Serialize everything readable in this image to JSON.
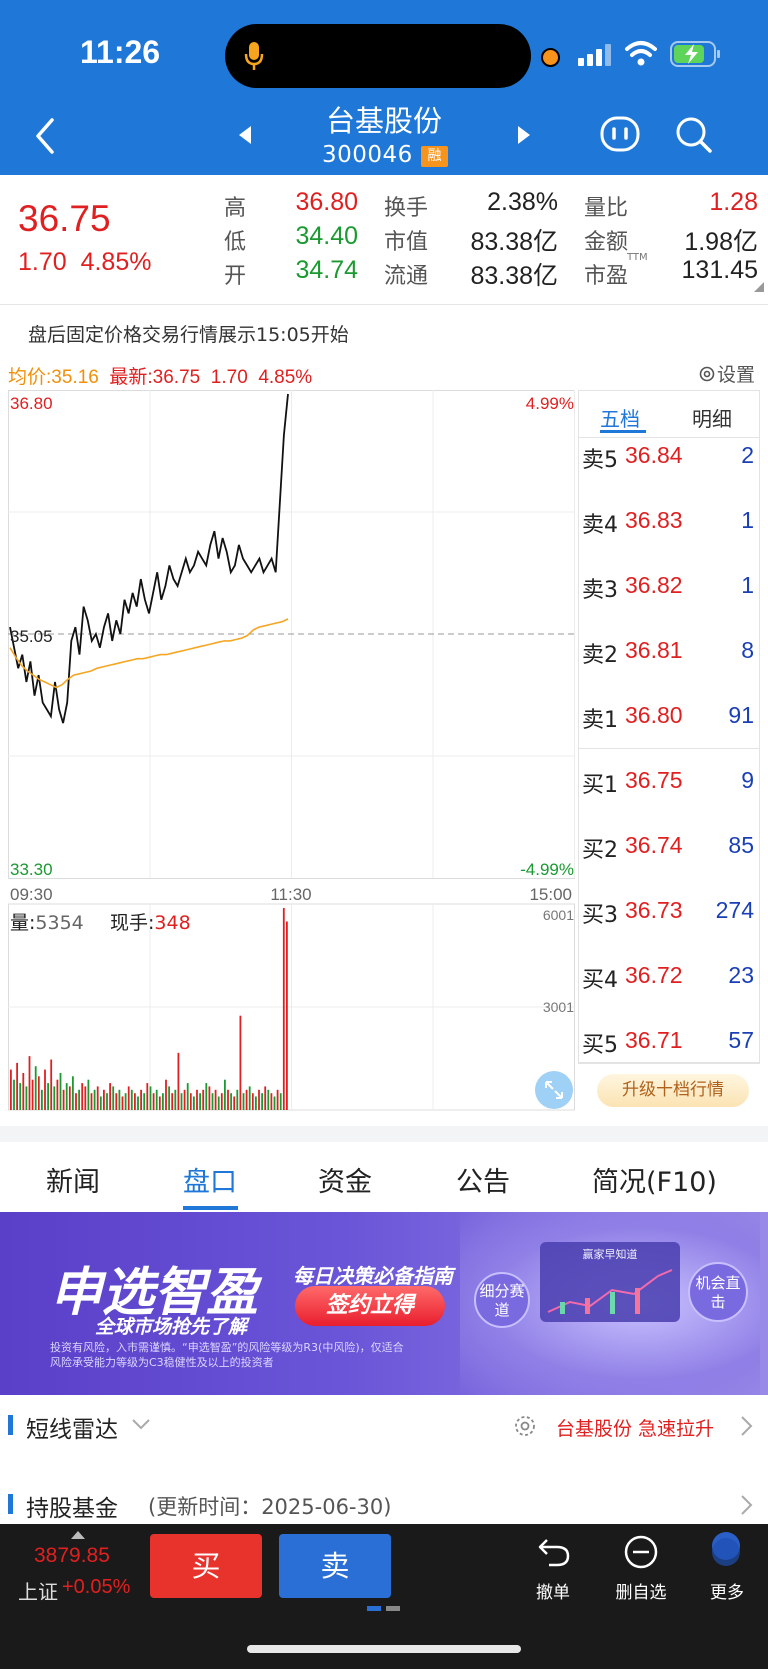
{
  "status_bar": {
    "time": "11:26"
  },
  "header": {
    "title": "台基股份",
    "code": "300046",
    "badge": "融"
  },
  "quote": {
    "price": "36.75",
    "change": "1.70",
    "change_pct": "4.85%",
    "stats": [
      {
        "label": "高",
        "value": "36.80",
        "color": "#e02020"
      },
      {
        "label": "换手",
        "value": "2.38%",
        "color": "#222222"
      },
      {
        "label": "量比",
        "value": "1.28",
        "color": "#e02020"
      },
      {
        "label": "低",
        "value": "34.40",
        "color": "#1a9a30"
      },
      {
        "label": "市值",
        "value": "83.38亿",
        "color": "#222222"
      },
      {
        "label": "金额",
        "value": "1.98亿",
        "color": "#222222"
      },
      {
        "label": "开",
        "value": "34.74",
        "color": "#1a9a30"
      },
      {
        "label": "流通",
        "value": "83.38亿",
        "color": "#222222"
      },
      {
        "label": "市盈",
        "value": "131.45",
        "color": "#222222"
      }
    ],
    "pe_suffix": "TTM"
  },
  "notice": "盘后固定价格交易行情展示15:05开始",
  "chart_header": {
    "avg_label": "均价:35.16",
    "latest_label": "最新:36.75",
    "latest_chg": "1.70",
    "latest_pct": "4.85%",
    "settings": "设置"
  },
  "chart_data": {
    "type": "line",
    "y_high": "36.80",
    "y_mid": "35.05",
    "y_low": "33.30",
    "pct_high": "4.99%",
    "pct_low": "-4.99%",
    "x_ticks": [
      "09:30",
      "11:30",
      "15:00"
    ],
    "ylim": [
      33.3,
      36.8
    ],
    "series": [
      {
        "values": [
          35.1,
          34.95,
          34.8,
          34.9,
          34.7,
          34.85,
          34.6,
          34.75,
          34.55,
          34.5,
          34.45,
          34.7,
          34.5,
          34.4,
          34.55,
          35.0,
          35.1,
          34.9,
          35.25,
          35.15,
          35.0,
          35.05,
          34.95,
          35.1,
          35.2,
          35.0,
          35.15,
          35.05,
          35.3,
          35.2,
          35.35,
          35.25,
          35.45,
          35.3,
          35.2,
          35.35,
          35.5,
          35.3,
          35.4,
          35.55,
          35.45,
          35.4,
          35.5,
          35.6,
          35.5,
          35.55,
          35.65,
          35.6,
          35.55,
          35.7,
          35.8,
          35.6,
          35.75,
          35.65,
          35.5,
          35.55,
          35.7,
          35.6,
          35.55,
          35.5,
          35.55,
          35.6,
          35.5,
          35.55,
          35.6,
          35.5,
          36.0,
          36.5,
          36.8
        ]
      },
      {
        "values": [
          34.95,
          34.88,
          34.82,
          34.78,
          34.75,
          34.72,
          34.7,
          34.68,
          34.66,
          34.68,
          34.72,
          34.75,
          34.76,
          34.77,
          34.78,
          34.8,
          34.81,
          34.82,
          34.83,
          34.84,
          34.85,
          34.86,
          34.87,
          34.87,
          34.88,
          34.89,
          34.9,
          34.9,
          34.91,
          34.92,
          34.93,
          34.94,
          34.95,
          34.96,
          34.97,
          34.98,
          34.99,
          35.0,
          35.0,
          35.01,
          35.02,
          35.04,
          35.08,
          35.1,
          35.11,
          35.12,
          35.13,
          35.14,
          35.16
        ]
      }
    ],
    "volume_label": "量:",
    "volume_value": "5354",
    "hand_label": "现手:",
    "hand_value": "348",
    "vol_ticks": [
      "6001",
      "3001"
    ],
    "volumes": [
      1200,
      900,
      1400,
      800,
      1100,
      700,
      1600,
      900,
      1300,
      1000,
      600,
      1200,
      800,
      1500,
      700,
      900,
      1100,
      600,
      800,
      700,
      1000,
      500,
      600,
      800,
      700,
      900,
      500,
      600,
      700,
      400,
      600,
      500,
      800,
      700,
      500,
      600,
      400,
      500,
      700,
      600,
      500,
      400,
      600,
      500,
      800,
      700,
      500,
      600,
      400,
      500,
      900,
      700,
      500,
      600,
      1700,
      500,
      600,
      800,
      500,
      400,
      600,
      500,
      600,
      800,
      700,
      500,
      600,
      400,
      500,
      900,
      600,
      500,
      400,
      600,
      2800,
      500,
      600,
      700,
      500,
      400,
      600,
      500,
      700,
      600,
      500,
      400,
      600,
      500,
      6001,
      5600
    ],
    "volume_colors": [
      "r",
      "g",
      "r",
      "g",
      "r",
      "g",
      "r",
      "r",
      "g",
      "r",
      "g",
      "r",
      "g",
      "r",
      "g",
      "r",
      "g",
      "r",
      "g",
      "r",
      "g",
      "r",
      "g",
      "r",
      "r",
      "g",
      "r",
      "g",
      "r",
      "g",
      "r",
      "g",
      "r",
      "g",
      "r",
      "g",
      "r",
      "g",
      "r",
      "g",
      "r",
      "g",
      "r",
      "g",
      "r",
      "g",
      "r",
      "g",
      "r",
      "g",
      "r",
      "g",
      "r",
      "g",
      "r",
      "g",
      "r",
      "g",
      "r",
      "g",
      "r",
      "g",
      "r",
      "g",
      "r",
      "g",
      "r",
      "g",
      "r",
      "g",
      "r",
      "g",
      "r",
      "g",
      "r",
      "g",
      "r",
      "g",
      "r",
      "g",
      "r",
      "g",
      "r",
      "g",
      "r",
      "g",
      "r",
      "g",
      "r",
      "r"
    ]
  },
  "order_book": {
    "tabs": [
      "五档",
      "明细"
    ],
    "asks": [
      {
        "label": "卖5",
        "price": "36.84",
        "vol": "2"
      },
      {
        "label": "卖4",
        "price": "36.83",
        "vol": "1"
      },
      {
        "label": "卖3",
        "price": "36.82",
        "vol": "1"
      },
      {
        "label": "卖2",
        "price": "36.81",
        "vol": "8"
      },
      {
        "label": "卖1",
        "price": "36.80",
        "vol": "91"
      }
    ],
    "bids": [
      {
        "label": "买1",
        "price": "36.75",
        "vol": "9"
      },
      {
        "label": "买2",
        "price": "36.74",
        "vol": "85"
      },
      {
        "label": "买3",
        "price": "36.73",
        "vol": "274"
      },
      {
        "label": "买4",
        "price": "36.72",
        "vol": "23"
      },
      {
        "label": "买5",
        "price": "36.71",
        "vol": "57"
      }
    ],
    "upgrade": "升级十档行情"
  },
  "nav_tabs": [
    "新闻",
    "盘口",
    "资金",
    "公告",
    "简况(F10)"
  ],
  "banner": {
    "title": "申选智盈",
    "sub1": "全球市场抢先了解",
    "sub2": "每日决策必备指南",
    "button": "签约立得",
    "disclaimer": "投资有风险，入市需谨慎。“申选智盈”的风险等级为R3(中风险)，仅适合风险承受能力等级为C3稳健性及以上的投资者",
    "tag1": "细分赛道",
    "tag2": "机会直击",
    "board": "赢家早知道"
  },
  "sections": {
    "radar_title": "短线雷达",
    "radar_alert": "台基股份 急速拉升",
    "fund_title": "持股基金",
    "fund_update": "(更新时间：2025-06-30)"
  },
  "bottom_bar": {
    "index_value": "3879.85",
    "index_name": "上证",
    "index_chg": "+0.05%",
    "buy": "买",
    "sell": "卖",
    "actions": [
      "撤单",
      "删自选",
      "更多"
    ]
  }
}
